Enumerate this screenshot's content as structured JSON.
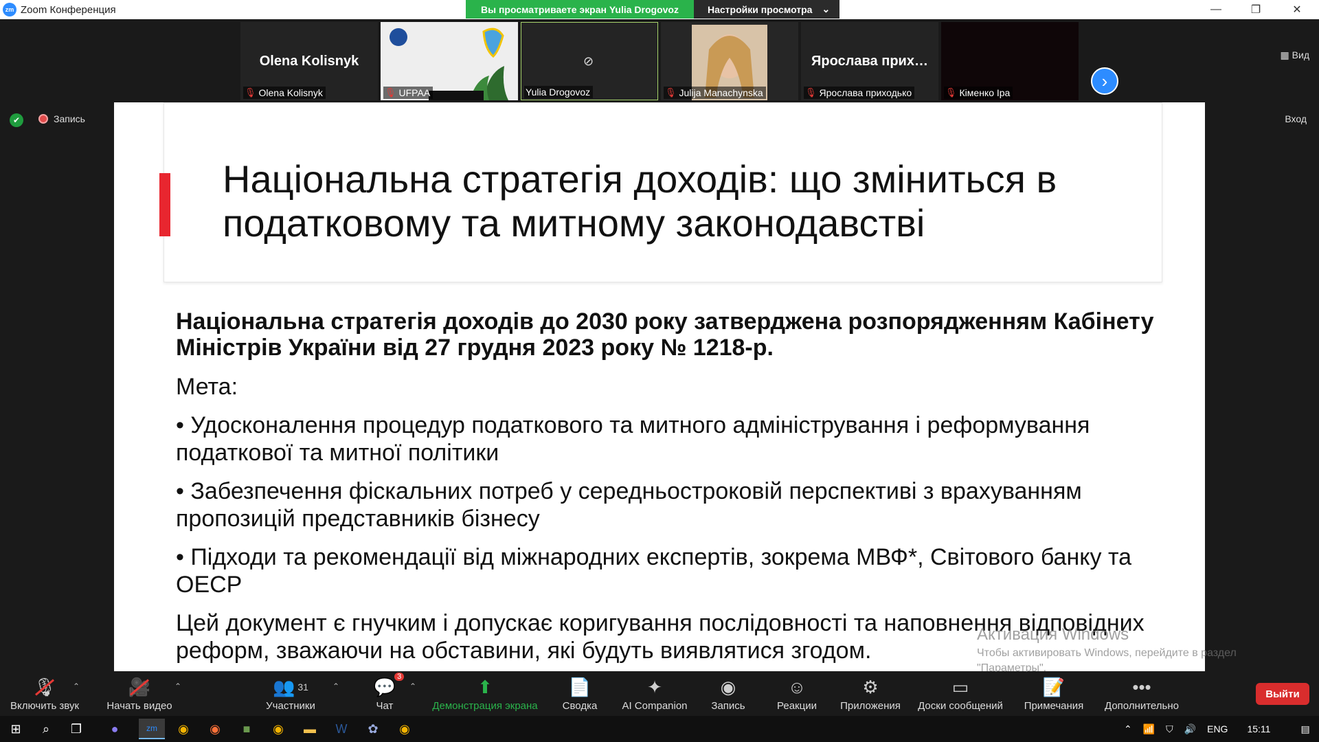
{
  "window": {
    "app_icon": "zm",
    "title": "Zoom Конференция",
    "controls": [
      "—",
      "❐",
      "✕"
    ]
  },
  "share_banner": {
    "viewing_text": "Вы просматриваете экран Yulia Drogovoz",
    "view_settings": "Настройки просмотра"
  },
  "gallery": {
    "tiles": [
      {
        "big_name": "Olena Kolisnyk",
        "label": "Olena Kolisnyk",
        "muted": true
      },
      {
        "big_name": "",
        "label": "UFPAA",
        "muted": true
      },
      {
        "big_name": "",
        "label": "Yulia Drogovoz",
        "muted": false
      },
      {
        "big_name": "",
        "label": "Julija Manachynska",
        "muted": true
      },
      {
        "big_name": "Ярослава прих…",
        "label": "Ярослава приходько",
        "muted": true
      },
      {
        "big_name": "",
        "label": "Кіменко Іра",
        "muted": true
      }
    ],
    "view_label": "Вид"
  },
  "status": {
    "recording_label": "Запись",
    "enter_label": "Вход"
  },
  "slide": {
    "title": "Національна стратегія доходів: що зміниться в податковому та митному законодавстві",
    "intro": "Національна стратегія доходів до 2030 року затверджена розпорядженням Кабінету Міністрів України від 27 грудня 2023 року № 1218-р.",
    "goal_label": "Мета:",
    "bullets": [
      "• Удосконалення процедур податкового та митного адміністрування і реформування податкової та митної політики",
      "• Забезпечення фіскальних потреб у середньостроковій перспективі з врахуванням пропозицій представників бізнесу",
      "• Підходи та рекомендації від міжнародних експертів, зокрема МВФ*, Світового банку та ОЕСР"
    ],
    "closing": "Цей документ є гнучким і допускає коригування послідовності та наповнення відповідних реформ, зважаючи на обставини, які будуть виявлятися згодом."
  },
  "watermark": {
    "line1": "Активация Windows",
    "line2": "Чтобы активировать Windows, перейдите в раздел",
    "line3": "\"Параметры\"."
  },
  "toolbar": {
    "audio": "Включить звук",
    "video": "Начать видео",
    "participants": "Участники",
    "participants_count": "31",
    "chat": "Чат",
    "chat_badge": "3",
    "share": "Демонстрация экрана",
    "summary": "Сводка",
    "ai": "AI Companion",
    "record": "Запись",
    "reactions": "Реакции",
    "apps": "Приложения",
    "whiteboards": "Доски сообщений",
    "notes": "Примечания",
    "more": "Дополнительно",
    "leave": "Выйти"
  },
  "taskbar": {
    "lang": "ENG",
    "time": "15:11"
  }
}
